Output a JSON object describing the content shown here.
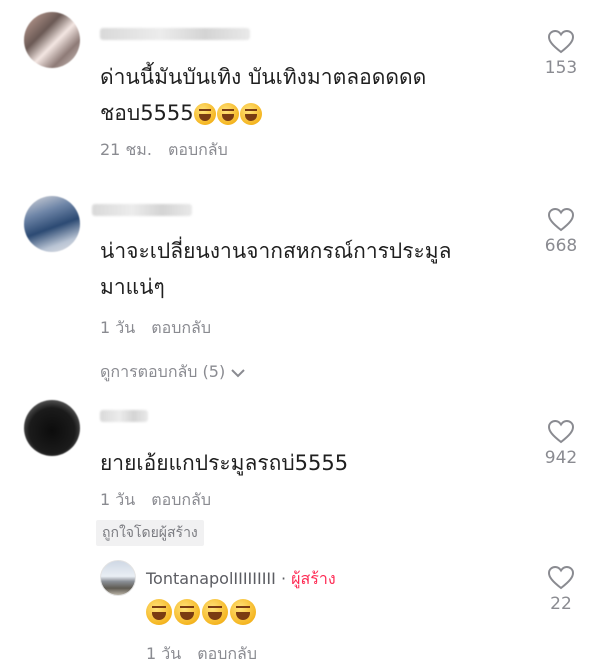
{
  "comments": [
    {
      "text_line1": "ด่านนี้มันบันเทิง บันเทิงมาตลอดดดด",
      "text_line2": "ชอบ5555",
      "emoji_count": 3,
      "time": "21 ชม.",
      "reply": "ตอบกลับ",
      "likes": "153"
    },
    {
      "text_line1": "น่าจะเปลี่ยนงานจากสหกรณ์การประมูล",
      "text_line2": "มาแน่ๆ",
      "time": "1 วัน",
      "reply": "ตอบกลับ",
      "likes": "668",
      "view_replies": "ดูการตอบกลับ (5)"
    },
    {
      "text_line1": "ยายเอ้ยแกประมูลรถบ่5555",
      "time": "1 วัน",
      "reply": "ตอบกลับ",
      "likes": "942",
      "liked_by_creator": "ถูกใจโดยผู้สร้าง"
    }
  ],
  "creator_reply": {
    "username": "TontanapolIIIIIIIII",
    "separator": "·",
    "creator_label": "ผู้สร้าง",
    "emoji_count": 4,
    "time": "1 วัน",
    "reply": "ตอบกลับ",
    "likes": "22"
  },
  "icons": {
    "like": "heart-outline-icon",
    "expand": "chevron-down-icon",
    "emoji": "grinning-face-emoji"
  },
  "colors": {
    "meta_text": "#8a8b91",
    "creator_accent": "#fe2c55"
  }
}
